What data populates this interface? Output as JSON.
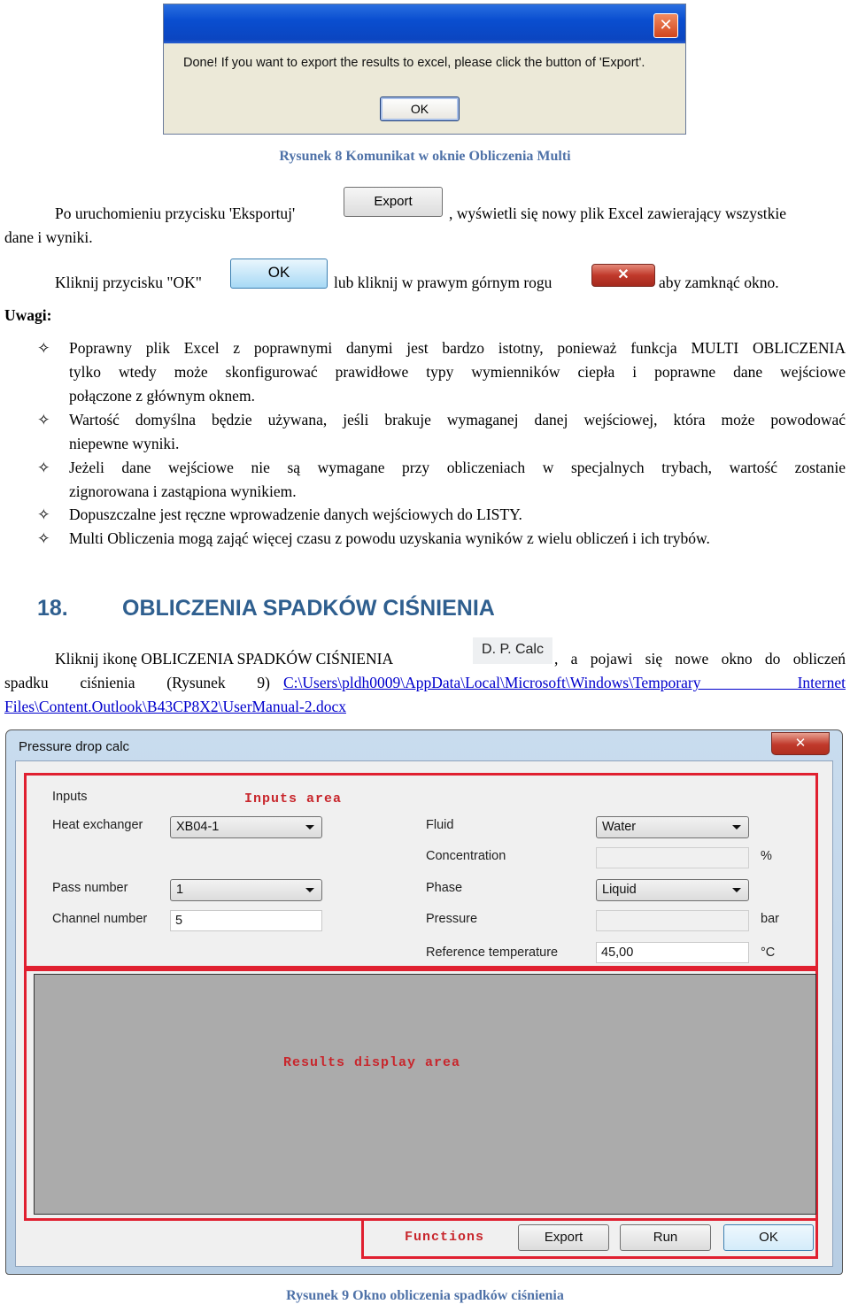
{
  "figure8": {
    "dialog_message": "Done! If you want to export the results to excel, please click the button of 'Export'.",
    "dialog_ok": "OK",
    "close_glyph": "✕",
    "caption": "Rysunek 8 Komunikat w oknie Obliczenia Multi"
  },
  "export_para": {
    "before": "Po uruchomieniu przycisku 'Eksportuj'",
    "button": "Export",
    "after": ", wyświetli się nowy plik Excel zawierający wszystkie",
    "line2": "dane i wyniki."
  },
  "ok_para": {
    "before": "Kliknij przycisku \"OK\"",
    "button": "OK",
    "middle": "lub kliknij w prawym górnym rogu",
    "close_glyph": "✕",
    "after": "aby zamknąć okno."
  },
  "notes": {
    "title": "Uwagi:",
    "bullet_glyph": "✧",
    "items": [
      {
        "lines": [
          "Poprawny plik Excel z poprawnymi danymi jest bardzo istotny, ponieważ funkcja MULTI OBLICZENIA",
          "tylko wtedy może skonfigurować prawidłowe typy wymienników ciepła i poprawne dane wejściowe",
          "połączone z głównym oknem."
        ]
      },
      {
        "lines": [
          "Wartość domyślna będzie używana, jeśli brakuje wymaganej danej wejściowej, która może powodować",
          "niepewne wyniki."
        ]
      },
      {
        "lines": [
          "Jeżeli dane wejściowe nie są wymagane przy obliczeniach w specjalnych trybach, wartość zostanie",
          "zignorowana i zastąpiona wynikiem."
        ]
      },
      {
        "lines": [
          "Dopuszczalne jest ręczne wprowadzenie danych wejściowych do LISTY."
        ]
      },
      {
        "lines": [
          "Multi Obliczenia mogą zająć więcej czasu z powodu uzyskania wyników z wielu obliczeń i ich trybów."
        ]
      }
    ]
  },
  "section": {
    "number": "18.",
    "title": "OBLICZENIA SPADKÓW CIŚNIENIA",
    "intro_before": "Kliknij ikonę OBLICZENIA SPADKÓW CIŚNIENIA",
    "icon_label": "D. P. Calc",
    "intro_after": ", a pojawi się nowe okno do obliczeń",
    "line2_text": "spadku ciśnienia (Rysunek 9)",
    "link_line1": "C:\\Users\\pldh0009\\AppData\\Local\\Microsoft\\Windows\\Temporary Internet",
    "link_line2": "Files\\Content.Outlook\\B43CP8X2\\UserManual-2.docx"
  },
  "figure9": {
    "window_title": "Pressure drop calc",
    "close_glyph": "✕",
    "inputs_heading": "Inputs",
    "inputs_area_label": "Inputs area",
    "results_area_label": "Results display area",
    "functions_label": "Functions",
    "left_fields": [
      {
        "label": "Heat exchanger",
        "type": "combo",
        "value": "XB04-1"
      },
      {
        "label": "Pass number",
        "type": "combo",
        "value": "1"
      },
      {
        "label": "Channel number",
        "type": "text",
        "value": "5"
      }
    ],
    "right_fields": [
      {
        "label": "Fluid",
        "type": "combo",
        "value": "Water",
        "unit": ""
      },
      {
        "label": "Concentration",
        "type": "text",
        "value": "",
        "unit": "%"
      },
      {
        "label": "Phase",
        "type": "combo",
        "value": "Liquid",
        "unit": ""
      },
      {
        "label": "Pressure",
        "type": "text",
        "value": "",
        "unit": "bar"
      },
      {
        "label": "Reference temperature",
        "type": "text",
        "value": "45,00",
        "unit": "°C"
      }
    ],
    "buttons": {
      "export": "Export",
      "run": "Run",
      "ok": "OK"
    },
    "caption": "Rysunek 9 Okno obliczenia spadków ciśnienia"
  }
}
